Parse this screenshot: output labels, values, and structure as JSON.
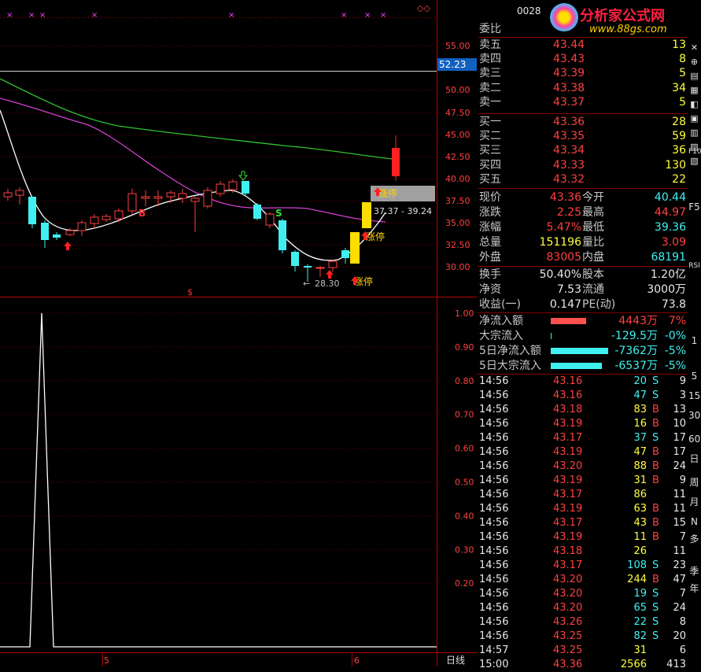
{
  "stock_code": "0028",
  "logo": {
    "name": "分析家公式网",
    "url": "www.88gs.com"
  },
  "price_axis": [
    "55.00",
    "52.23",
    "50.00",
    "47.50",
    "45.00",
    "42.50",
    "40.00",
    "37.50",
    "35.00",
    "32.50",
    "30.00"
  ],
  "current_line_label": "52.23",
  "indicator_axis": [
    "1.00",
    "0.90",
    "0.80",
    "0.70",
    "0.60",
    "0.50",
    "0.40",
    "0.30",
    "0.20"
  ],
  "date_axis": [
    "5",
    "6"
  ],
  "period_label": "日线",
  "annotations": {
    "zhangting1": "涨停",
    "zhangting2": "涨停",
    "zhangting3": "涨停",
    "range_box": "37.37 - 39.24",
    "low_label": "28.30",
    "b_mark": "B",
    "s_mark": "S"
  },
  "quote": {
    "weibi_label": "委比",
    "sell": [
      {
        "label": "卖五",
        "price": "43.44",
        "vol": "13"
      },
      {
        "label": "卖四",
        "price": "43.43",
        "vol": "8"
      },
      {
        "label": "卖三",
        "price": "43.39",
        "vol": "5"
      },
      {
        "label": "卖二",
        "price": "43.38",
        "vol": "34"
      },
      {
        "label": "卖一",
        "price": "43.37",
        "vol": "5"
      }
    ],
    "buy": [
      {
        "label": "买一",
        "price": "43.36",
        "vol": "28"
      },
      {
        "label": "买二",
        "price": "43.35",
        "vol": "59"
      },
      {
        "label": "买三",
        "price": "43.34",
        "vol": "36"
      },
      {
        "label": "买四",
        "price": "43.33",
        "vol": "130"
      },
      {
        "label": "买五",
        "price": "43.32",
        "vol": "22"
      }
    ],
    "stats": [
      {
        "l1": "现价",
        "v1": "43.36",
        "l2": "今开",
        "v2": "40.44"
      },
      {
        "l1": "涨跌",
        "v1": "2.25",
        "l2": "最高",
        "v2": "44.97"
      },
      {
        "l1": "涨幅",
        "v1": "5.47%",
        "l2": "最低",
        "v2": "39.36"
      },
      {
        "l1": "总量",
        "v1": "151196",
        "l2": "量比",
        "v2": "3.09"
      },
      {
        "l1": "外盘",
        "v1": "83005",
        "l2": "内盘",
        "v2": "68191"
      }
    ],
    "stats2": [
      {
        "l1": "换手",
        "v1": "50.40%",
        "l2": "股本",
        "v2": "1.20亿"
      },
      {
        "l1": "净资",
        "v1": "7.53",
        "l2": "流通",
        "v2": "3000万"
      },
      {
        "l1": "收益(一)",
        "v1": "0.147",
        "l2": "PE(动)",
        "v2": "73.8"
      }
    ],
    "flows": [
      {
        "label": "净流入额",
        "value": "4443万",
        "pct": "7%",
        "bar_frac": 0.18,
        "color": "#ff5050"
      },
      {
        "label": "大宗流入",
        "value": "-129.5万",
        "pct": "-0%",
        "bar_frac": 0.005,
        "color": "#40f0f0"
      },
      {
        "label": "5日净流入额",
        "value": "-7362万",
        "pct": "-5%",
        "bar_frac": 0.29,
        "color": "#40f0f0"
      },
      {
        "label": "5日大宗流入",
        "value": "-6537万",
        "pct": "-5%",
        "bar_frac": 0.26,
        "color": "#40f0f0"
      }
    ]
  },
  "ticks": [
    {
      "t": "14:56",
      "p": "43.16",
      "v": "20",
      "d": "S",
      "n": "9"
    },
    {
      "t": "14:56",
      "p": "43.16",
      "v": "47",
      "d": "S",
      "n": "3"
    },
    {
      "t": "14:56",
      "p": "43.18",
      "v": "83",
      "d": "B",
      "n": "13"
    },
    {
      "t": "14:56",
      "p": "43.19",
      "v": "16",
      "d": "B",
      "n": "10"
    },
    {
      "t": "14:56",
      "p": "43.17",
      "v": "37",
      "d": "S",
      "n": "17"
    },
    {
      "t": "14:56",
      "p": "43.19",
      "v": "47",
      "d": "B",
      "n": "17"
    },
    {
      "t": "14:56",
      "p": "43.20",
      "v": "88",
      "d": "B",
      "n": "24"
    },
    {
      "t": "14:56",
      "p": "43.19",
      "v": "31",
      "d": "B",
      "n": "9"
    },
    {
      "t": "14:56",
      "p": "43.17",
      "v": "86",
      "d": "",
      "n": "11"
    },
    {
      "t": "14:56",
      "p": "43.19",
      "v": "63",
      "d": "B",
      "n": "11"
    },
    {
      "t": "14:56",
      "p": "43.17",
      "v": "43",
      "d": "B",
      "n": "15"
    },
    {
      "t": "14:56",
      "p": "43.19",
      "v": "11",
      "d": "B",
      "n": "7"
    },
    {
      "t": "14:56",
      "p": "43.18",
      "v": "26",
      "d": "",
      "n": "11"
    },
    {
      "t": "14:56",
      "p": "43.17",
      "v": "108",
      "d": "S",
      "n": "23"
    },
    {
      "t": "14:56",
      "p": "43.20",
      "v": "244",
      "d": "B",
      "n": "47"
    },
    {
      "t": "14:56",
      "p": "43.20",
      "v": "19",
      "d": "S",
      "n": "7"
    },
    {
      "t": "14:56",
      "p": "43.20",
      "v": "65",
      "d": "S",
      "n": "24"
    },
    {
      "t": "14:56",
      "p": "43.26",
      "v": "22",
      "d": "S",
      "n": "8"
    },
    {
      "t": "14:56",
      "p": "43.25",
      "v": "82",
      "d": "S",
      "n": "20"
    },
    {
      "t": "14:57",
      "p": "43.25",
      "v": "31",
      "d": "",
      "n": "6"
    },
    {
      "t": "15:00",
      "p": "43.36",
      "v": "2566",
      "d": "",
      "n": "413"
    }
  ],
  "toolbar_labels": [
    "F10",
    "F5",
    "RSI",
    "1",
    "5",
    "15",
    "30",
    "60",
    "日",
    "周",
    "月",
    "N",
    "多",
    "季",
    "年"
  ]
}
